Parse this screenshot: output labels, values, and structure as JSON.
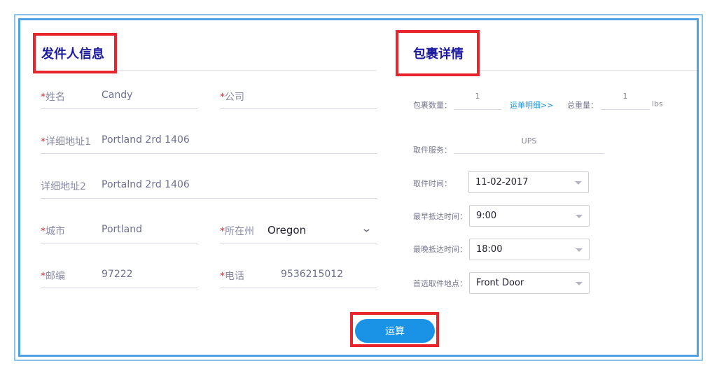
{
  "sender": {
    "title": "发件人信息",
    "required_mark": "*",
    "name_label": "姓名",
    "name_value": "Candy",
    "company_label": "公司",
    "company_value": "",
    "address1_label": "详细地址1",
    "address1_value": "Portland 2rd 1406",
    "address2_label": "详细地址2",
    "address2_value": "Portalnd 2rd 1406",
    "city_label": "城市",
    "city_value": "Portland",
    "state_label": "所在州",
    "state_value": "Oregon",
    "zip_label": "邮编",
    "zip_value": "97222",
    "phone_label": "电话",
    "phone_value": "9536215012"
  },
  "package": {
    "title": "包裹详情",
    "count_label": "包裹数量：",
    "count_value": "1",
    "detail_link": "运单明细>>",
    "weight_label": "总重量：",
    "weight_value": "1",
    "weight_unit": "lbs",
    "service_label": "取件服务：",
    "service_value": "UPS",
    "pickup_time_label": "取件时间：",
    "pickup_time_value": "11-02-2017",
    "earliest_label": "最早抵达时间：",
    "earliest_value": "9:00",
    "latest_label": "最晚抵达时间：",
    "latest_value": "18:00",
    "location_label": "首选取件地点：",
    "location_value": "Front Door"
  },
  "actions": {
    "calculate_label": "运算"
  },
  "colors": {
    "accent_blue": "#1a93e6",
    "frame_blue": "#4ea3e6",
    "highlight_red": "#e8242c",
    "title_navy": "#1c1a9e"
  }
}
